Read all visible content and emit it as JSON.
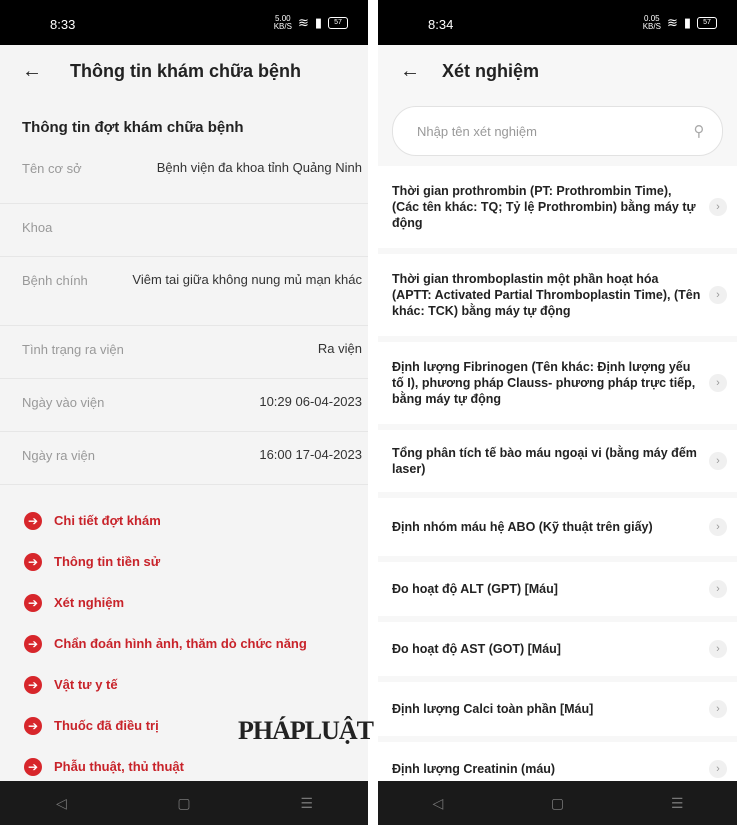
{
  "left": {
    "status": {
      "time": "8:33",
      "net_speed": "5.00",
      "net_unit": "KB/S",
      "battery": "57"
    },
    "appbar": {
      "title": "Thông tin khám chữa bệnh"
    },
    "section_title": "Thông tin đợt khám chữa bệnh",
    "rows": [
      {
        "label": "Tên cơ sở",
        "value": "Bệnh viện đa khoa tỉnh Quảng Ninh"
      },
      {
        "label": "Khoa",
        "value": ""
      },
      {
        "label": "Bệnh chính",
        "value": "Viêm tai giữa không nung mủ mạn khác"
      },
      {
        "label": "Tình trạng ra viện",
        "value": "Ra viện"
      },
      {
        "label": "Ngày vào viện",
        "value": "10:29 06-04-2023"
      },
      {
        "label": "Ngày ra viện",
        "value": "16:00 17-04-2023"
      }
    ],
    "links": [
      "Chi tiết đợt khám",
      "Thông tin tiền sử",
      "Xét nghiệm",
      "Chẩn đoán hình ảnh, thăm dò chức năng",
      "Vật tư y tế",
      "Thuốc đã điều trị",
      "Phẫu thuật, thủ thuật"
    ]
  },
  "right": {
    "status": {
      "time": "8:34",
      "net_speed": "0.05",
      "net_unit": "KB/S",
      "battery": "57"
    },
    "appbar": {
      "title": "Xét nghiệm"
    },
    "search": {
      "placeholder": "Nhập tên xét nghiệm"
    },
    "tests": [
      "Thời gian prothrombin (PT: Prothrombin Time), (Các tên khác: TQ; Tỷ lệ Prothrombin) bằng máy tự động",
      "Thời gian thromboplastin một phần hoạt hóa (APTT: Activated Partial Thromboplastin Time), (Tên khác: TCK) bằng máy tự động",
      "Định lượng Fibrinogen (Tên khác: Định lượng yếu tố I), phương pháp Clauss- phương pháp trực tiếp, bằng máy tự động",
      "Tổng phân tích tế bào máu ngoại vi (bằng máy đếm laser)",
      "Định nhóm máu hệ ABO (Kỹ thuật trên giấy)",
      "Đo hoạt độ ALT (GPT) [Máu]",
      "Đo hoạt độ AST (GOT) [Máu]",
      "Định lượng Calci toàn phần [Máu]",
      "Định lượng Creatinin (máu)"
    ]
  },
  "watermark": "PHÁPLUẬT",
  "colors": {
    "accent": "#d7262b",
    "statusbar": "#000000",
    "navbar": "#1a1a1a"
  },
  "icons": {
    "back": "arrow-left-icon",
    "search": "search-icon",
    "chevron": "chevron-right-icon",
    "link": "arrow-circle-right-icon"
  }
}
